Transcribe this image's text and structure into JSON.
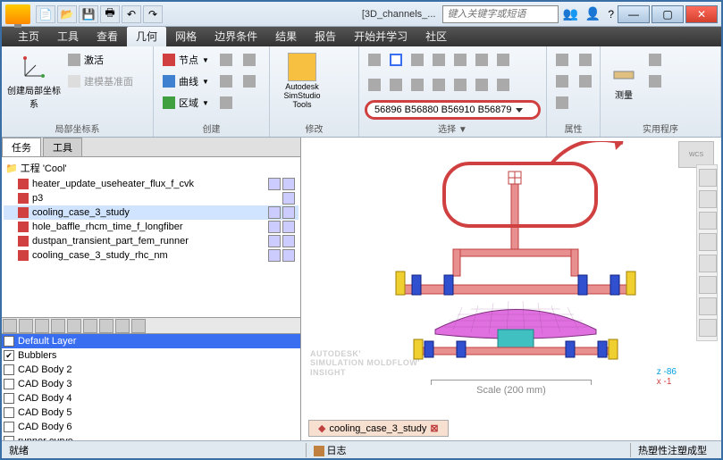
{
  "titlebar": {
    "document_title": "[3D_channels_...",
    "search_placeholder": "键入关键字或短语"
  },
  "menubar": {
    "items": [
      "主页",
      "工具",
      "查看",
      "几何",
      "网格",
      "边界条件",
      "结果",
      "报告",
      "开始并学习",
      "社区"
    ],
    "active_index": 3
  },
  "ribbon": {
    "groups": {
      "local_cs": {
        "label": "局部坐标系",
        "create_btn": "创建局部坐标系",
        "activate": "激活",
        "base": "建模基准面"
      },
      "create": {
        "label": "创建",
        "node": "节点",
        "curve": "曲线",
        "region": "区域"
      },
      "modify": {
        "label": "修改",
        "simstudio": "Autodesk\nSimStudio Tools"
      },
      "select": {
        "label": "选择 ▼",
        "selection_text": "56896 B56880 B56910 B56879"
      },
      "properties": {
        "label": "属性"
      },
      "utilities": {
        "label": "实用程序",
        "measure": "测量"
      }
    }
  },
  "left_panel": {
    "tabs": [
      "任务",
      "工具"
    ],
    "project_label": "工程 'Cool'",
    "tree": [
      {
        "icon": "red",
        "label": "heater_update_useheater_flux_f_cvk",
        "badges": 2
      },
      {
        "icon": "red",
        "label": "p3",
        "badges": 1
      },
      {
        "icon": "red",
        "label": "cooling_case_3_study",
        "badges": 2,
        "selected": true
      },
      {
        "icon": "red",
        "label": "hole_baffle_rhcm_time_f_longfiber",
        "badges": 2
      },
      {
        "icon": "red",
        "label": "dustpan_transient_part_fem_runner",
        "badges": 2
      },
      {
        "icon": "red",
        "label": "cooling_case_3_study_rhc_nm",
        "badges": 2
      }
    ],
    "layers": [
      {
        "label": "Default Layer",
        "checked": false,
        "default": true
      },
      {
        "label": "Bubblers",
        "checked": true
      },
      {
        "label": "CAD Body 2",
        "checked": false
      },
      {
        "label": "CAD Body 3",
        "checked": false
      },
      {
        "label": "CAD Body 4",
        "checked": false
      },
      {
        "label": "CAD Body 5",
        "checked": false
      },
      {
        "label": "CAD Body 6",
        "checked": false
      },
      {
        "label": "runner curve",
        "checked": false
      }
    ]
  },
  "viewport": {
    "tab_label": "cooling_case_3_study",
    "watermark_line1": "AUTODESK'",
    "watermark_line2": "SIMULATION MOLDFLOW'",
    "watermark_line3": "INSIGHT",
    "scale_label": "Scale (200 mm)",
    "axis_z": "z  -86",
    "axis_x": "x  -1"
  },
  "statusbar": {
    "ready": "就绪",
    "log": "日志",
    "mode": "热塑性注塑成型"
  }
}
